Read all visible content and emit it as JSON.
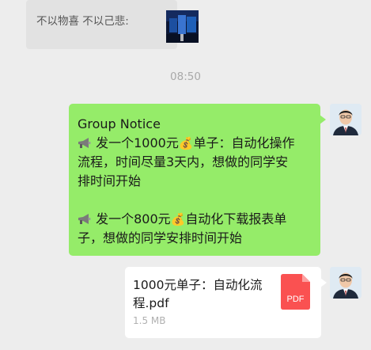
{
  "quote": {
    "text": "不以物喜 不以己悲:"
  },
  "timestamp": "08:50",
  "message": {
    "title": "Group Notice",
    "emoji_money": "💰",
    "para1_line1_a": "发一个1000元",
    "para1_line1_b": "单子：自动化操作",
    "para1_line2": "流程，时间尽量3天内，想做的同学安",
    "para1_line3": "排时间开始",
    "para2_line1_a": "发一个800元",
    "para2_line1_b": "自动化下载报表单",
    "para2_line2": "子，想做的同学安排时间开始"
  },
  "file": {
    "name_line1": "1000元单子：自动化流",
    "name_line2": "程.pdf",
    "size": "1.5 MB",
    "type_label": "PDF"
  },
  "colors": {
    "bubble_green": "#95ec69",
    "pdf_red": "#fa5151",
    "background": "#ededed"
  }
}
